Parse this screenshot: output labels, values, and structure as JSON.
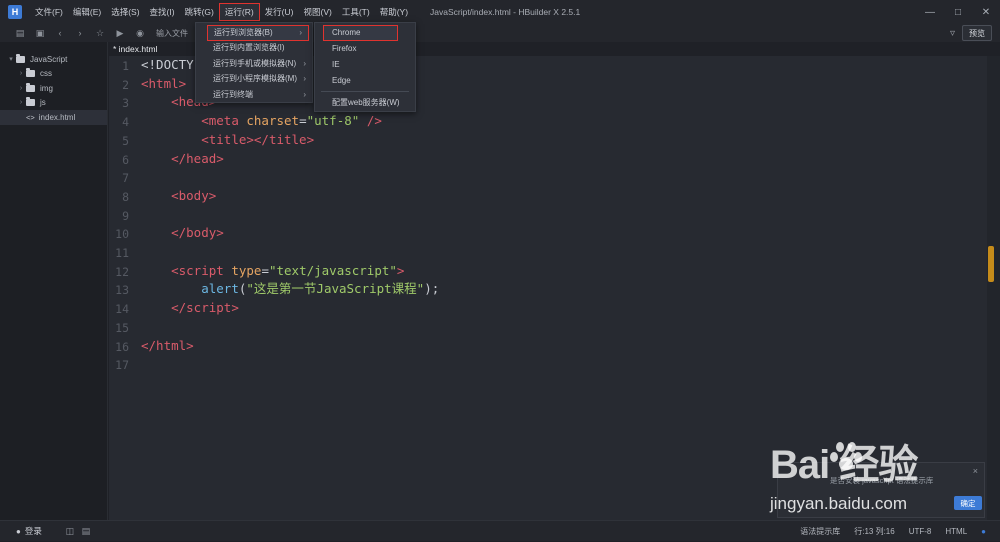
{
  "app": {
    "window_title": "JavaScript/index.html - HBuilder X 2.5.1",
    "logo": "H"
  },
  "menu": [
    {
      "label": "文件(F)"
    },
    {
      "label": "编辑(E)"
    },
    {
      "label": "选择(S)"
    },
    {
      "label": "查找(I)"
    },
    {
      "label": "跳转(G)"
    },
    {
      "label": "运行(R)",
      "active": true
    },
    {
      "label": "发行(U)"
    },
    {
      "label": "视图(V)"
    },
    {
      "label": "工具(T)"
    },
    {
      "label": "帮助(Y)"
    }
  ],
  "toolbar": {
    "input_hint": "输入文件",
    "preview_label": "预览"
  },
  "sidebar": {
    "project": "JavaScript",
    "items": [
      {
        "label": "css",
        "type": "folder"
      },
      {
        "label": "img",
        "type": "folder"
      },
      {
        "label": "js",
        "type": "folder"
      },
      {
        "label": "index.html",
        "type": "file"
      }
    ]
  },
  "editor": {
    "tab_label": "* index.html",
    "line_numbers": [
      "1",
      "2",
      "3",
      "4",
      "5",
      "6",
      "7",
      "8",
      "9",
      "10",
      "11",
      "12",
      "13",
      "14",
      "15",
      "16",
      "17"
    ]
  },
  "run_menu": {
    "items": [
      {
        "label": "运行到浏览器(B)",
        "submenu": true
      },
      {
        "label": "运行到内置浏览器(I)"
      },
      {
        "label": "运行到手机或模拟器(N)",
        "submenu": true
      },
      {
        "label": "运行到小程序模拟器(M)",
        "submenu": true
      },
      {
        "label": "运行到终端",
        "submenu": true
      }
    ]
  },
  "browser_menu": {
    "items": [
      {
        "label": "Chrome"
      },
      {
        "label": "Firefox"
      },
      {
        "label": "IE"
      },
      {
        "label": "Edge"
      },
      {
        "label": "配置web服务器(W)"
      }
    ]
  },
  "statusbar": {
    "login": "登录",
    "syntax_hint": "语法提示库",
    "position": "行:13  列:16",
    "encoding": "UTF-8",
    "language": "HTML"
  },
  "toast": {
    "text": "是否安装 javascript 语法提示库",
    "button": "确定"
  },
  "watermark": {
    "logo": "Bai  经验",
    "url": "jingyan.baidu.com"
  },
  "colors": {
    "highlight_border": "#e0332f",
    "tag": "#d95b6a",
    "attribute": "#e5a462",
    "string": "#9fc969",
    "function": "#6cb7e3"
  }
}
